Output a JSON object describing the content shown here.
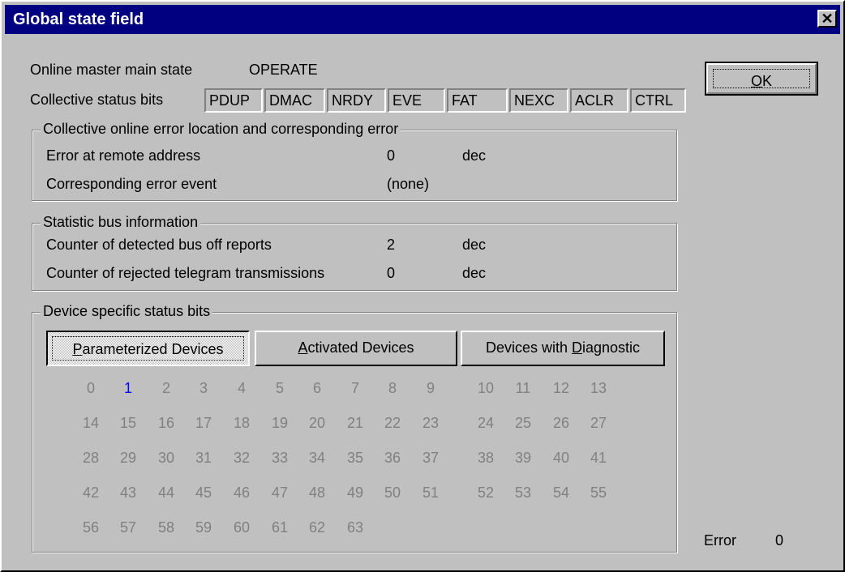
{
  "window": {
    "title": "Global state field",
    "close_glyph": "✕"
  },
  "master_state": {
    "label": "Online master main state",
    "value": "OPERATE"
  },
  "status_bits": {
    "label": "Collective status bits",
    "items": [
      "PDUP",
      "DMAC",
      "NRDY",
      "EVE",
      "FAT",
      "NEXC",
      "ACLR",
      "CTRL"
    ]
  },
  "error_location": {
    "title": "Collective online error location and corresponding error",
    "remote_address_label": "Error at remote address",
    "remote_address_value": "0",
    "remote_address_unit": "dec",
    "error_event_label": "Corresponding error event",
    "error_event_value": "(none)"
  },
  "bus_info": {
    "title": "Statistic bus information",
    "bus_off_label": "Counter of detected bus off reports",
    "bus_off_value": "2",
    "bus_off_unit": "dec",
    "rejected_label": "Counter of rejected telegram transmissions",
    "rejected_value": "0",
    "rejected_unit": "dec"
  },
  "device_bits": {
    "title": "Device specific status bits",
    "tabs": [
      {
        "pre": "",
        "ul": "P",
        "post": "arameterized Devices",
        "pressed": true
      },
      {
        "pre": "",
        "ul": "A",
        "post": "ctivated Devices",
        "pressed": false
      },
      {
        "pre": "Devices with ",
        "ul": "D",
        "post": "iagnostic",
        "pressed": false
      }
    ],
    "numbers": [
      "0",
      "1",
      "2",
      "3",
      "4",
      "5",
      "6",
      "7",
      "8",
      "9",
      "10",
      "11",
      "12",
      "13",
      "14",
      "15",
      "16",
      "17",
      "18",
      "19",
      "20",
      "21",
      "22",
      "23",
      "24",
      "25",
      "26",
      "27",
      "28",
      "29",
      "30",
      "31",
      "32",
      "33",
      "34",
      "35",
      "36",
      "37",
      "38",
      "39",
      "40",
      "41",
      "42",
      "43",
      "44",
      "45",
      "46",
      "47",
      "48",
      "49",
      "50",
      "51",
      "52",
      "53",
      "54",
      "55",
      "56",
      "57",
      "58",
      "59",
      "60",
      "61",
      "62",
      "63"
    ],
    "active": [
      "1"
    ]
  },
  "ok_button": {
    "ul": "O",
    "post": "K"
  },
  "error_status": {
    "label": "Error",
    "value": "0"
  }
}
